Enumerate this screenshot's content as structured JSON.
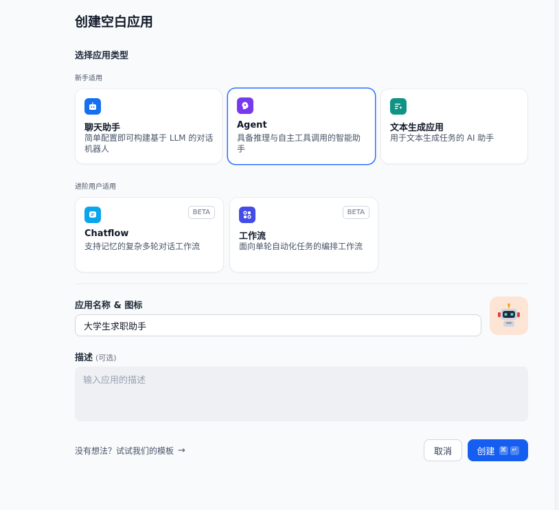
{
  "header": {
    "title": "创建空白应用"
  },
  "app_type": {
    "section_title": "选择应用类型",
    "beginner_label": "新手适用",
    "advanced_label": "进阶用户适用",
    "cards": [
      {
        "title": "聊天助手",
        "desc": "简单配置即可构建基于 LLM 的对话机器人",
        "icon": "chat-bot-icon",
        "color": "#1570ef"
      },
      {
        "title": "Agent",
        "desc": "具备推理与自主工具调用的智能助手",
        "icon": "agent-icon",
        "color": "#7839ee"
      },
      {
        "title": "文本生成应用",
        "desc": "用于文本生成任务的 AI 助手",
        "icon": "text-generation-icon",
        "color": "#0e9384"
      },
      {
        "title": "Chatflow",
        "desc": "支持记忆的复杂多轮对话工作流",
        "icon": "chatflow-icon",
        "color": "#0ba5ec",
        "badge": "BETA"
      },
      {
        "title": "工作流",
        "desc": "面向单轮自动化任务的编排工作流",
        "icon": "workflow-icon",
        "color": "#444ce7",
        "badge": "BETA"
      }
    ],
    "selected": "Agent"
  },
  "form": {
    "name_label": "应用名称 & 图标",
    "name_value": "大学生求职助手",
    "app_icon": "robot-icon",
    "desc_label": "描述",
    "desc_optional": "(可选)",
    "desc_placeholder": "输入应用的描述"
  },
  "footer": {
    "template_link": "没有想法？试试我们的模板",
    "cancel_label": "取消",
    "create_label": "创建",
    "shortcut_keys": [
      "⌘",
      "↵"
    ]
  },
  "colors": {
    "accent": "#155eef",
    "selected_border": "#296dff"
  }
}
